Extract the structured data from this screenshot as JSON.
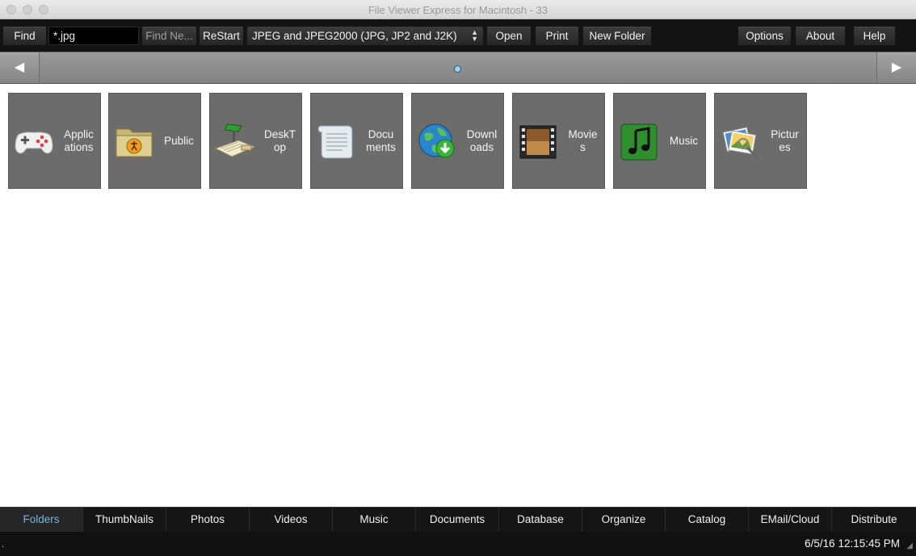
{
  "window": {
    "title": "File Viewer Express for Macintosh - 33"
  },
  "toolbar": {
    "find_label": "Find",
    "find_value": "*.jpg",
    "find_next_label": "Find Ne...",
    "restart_label": "ReStart",
    "filetype_selected": "JPEG and JPEG2000 (JPG, JP2 and J2K)",
    "open_label": "Open",
    "print_label": "Print",
    "new_folder_label": "New Folder",
    "options_label": "Options",
    "about_label": "About",
    "help_label": "Help"
  },
  "nav": {
    "prev_symbol": "◀",
    "next_symbol": "▶"
  },
  "folders": [
    {
      "label": "Applic\nations",
      "icon": "gamepad-icon"
    },
    {
      "label": "Public",
      "icon": "public-folder-icon"
    },
    {
      "label": "DeskT\nop",
      "icon": "desk-lamp-icon"
    },
    {
      "label": "Docu\nments",
      "icon": "scroll-document-icon"
    },
    {
      "label": "Downl\noads",
      "icon": "globe-download-icon"
    },
    {
      "label": "Movie\ns",
      "icon": "film-strip-icon"
    },
    {
      "label": "Music",
      "icon": "music-note-icon"
    },
    {
      "label": "Pictur\nes",
      "icon": "pictures-icon"
    }
  ],
  "tabs": [
    {
      "label": "Folders",
      "active": true
    },
    {
      "label": "ThumbNails"
    },
    {
      "label": "Photos"
    },
    {
      "label": "Videos"
    },
    {
      "label": "Music"
    },
    {
      "label": "Documents"
    },
    {
      "label": "Database"
    },
    {
      "label": "Organize"
    },
    {
      "label": "Catalog"
    },
    {
      "label": "EMail/Cloud"
    },
    {
      "label": "Distribute"
    }
  ],
  "status": {
    "datetime": "6/5/16 12:15:45 PM",
    "left_mark": "."
  },
  "colors": {
    "active_tab": "#6fb4e6",
    "tile_bg": "#6c6c6c",
    "toolbar_bg": "#141414"
  }
}
